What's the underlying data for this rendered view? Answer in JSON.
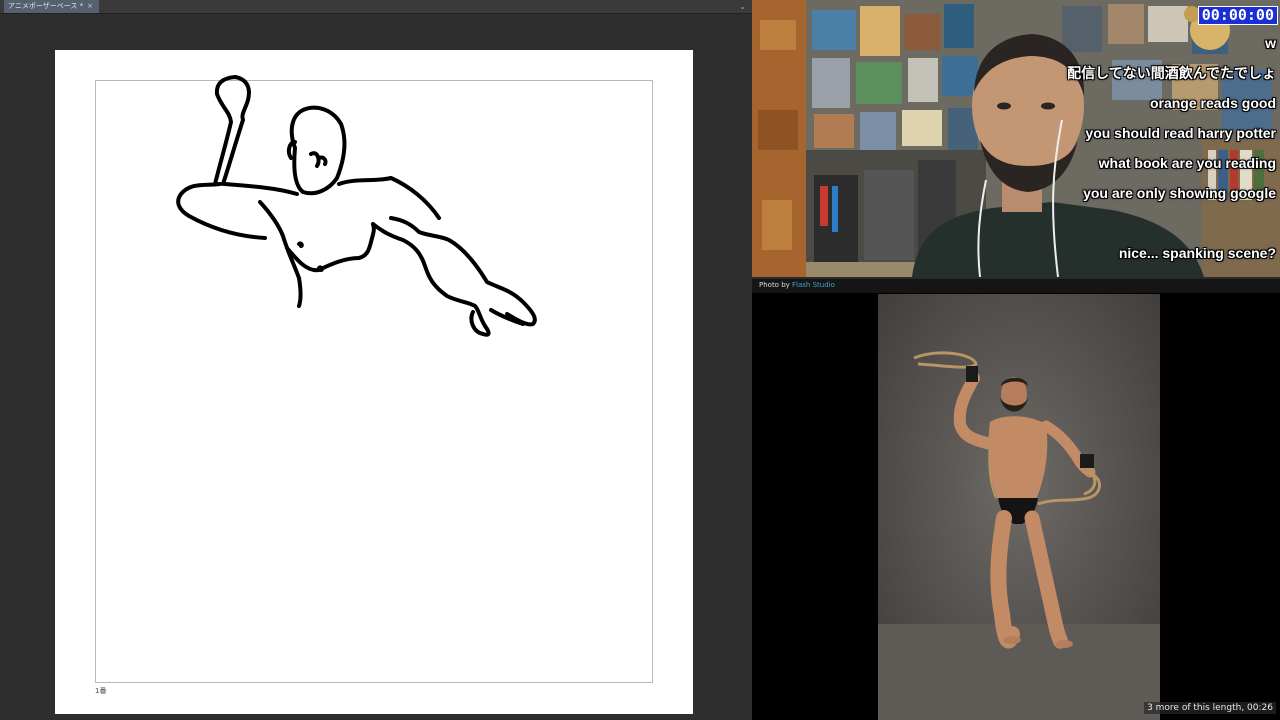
{
  "app": {
    "document_tab": "アニメポーザーベース *",
    "tab_close_icon": "close-icon",
    "tab_menu_icon": "chevron-down-icon",
    "page_label": "1番"
  },
  "stream": {
    "timer": "00:00:00",
    "chat_messages": [
      "w",
      "配信してない間酒飲んでたでしょ",
      "orange reads good",
      "you should read harry potter",
      "what book are you reading",
      "you are only showing google",
      "",
      "nice... spanking scene?"
    ]
  },
  "reference": {
    "credit_prefix": "Photo by",
    "credit_author": "Flash Studio",
    "footer": "3 more of this length, 00:26"
  },
  "colors": {
    "app_bg": "#2e2e2e",
    "paper": "#ffffff",
    "timer_bg": "#1a2fd8",
    "credit_link": "#3aa7c9"
  }
}
